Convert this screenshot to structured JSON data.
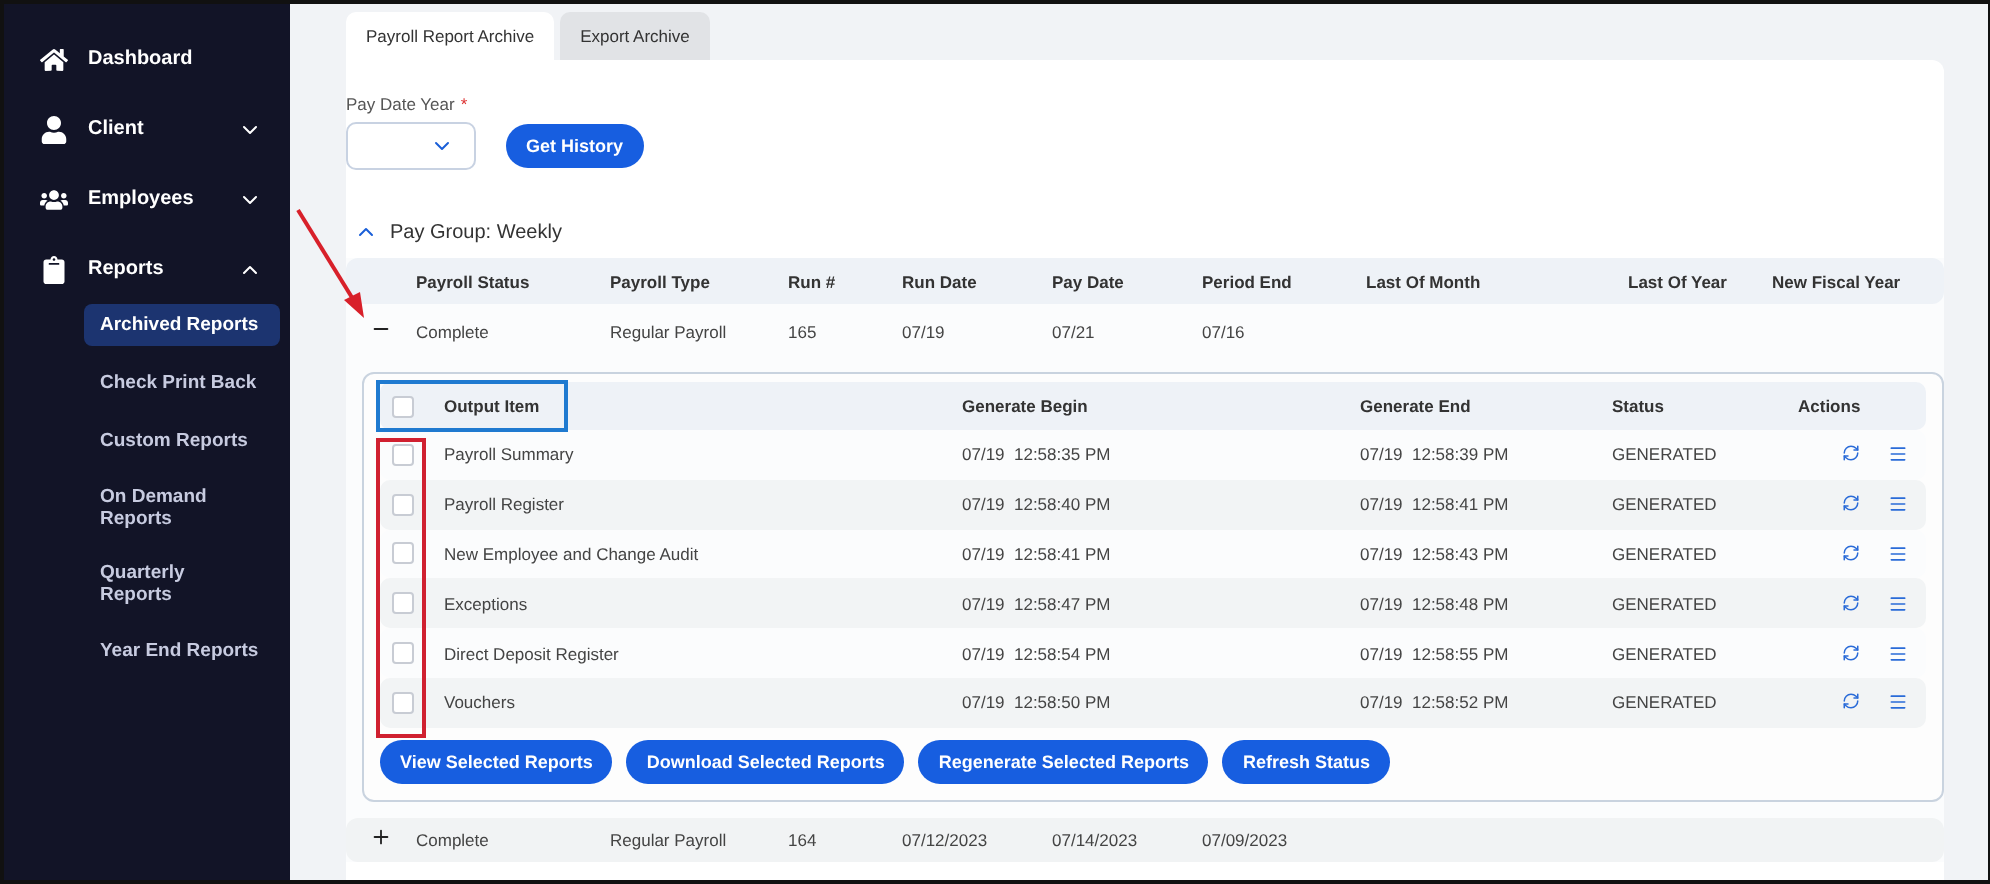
{
  "sidebar": {
    "items": [
      {
        "label": "Dashboard"
      },
      {
        "label": "Client",
        "expanded": false
      },
      {
        "label": "Employees",
        "expanded": false
      },
      {
        "label": "Reports",
        "expanded": true,
        "children": [
          {
            "label": "Archived Reports",
            "selected": true
          },
          {
            "label": "Check Print Back",
            "selected": false
          },
          {
            "label": "Custom Reports",
            "selected": false
          },
          {
            "label": "On Demand Reports",
            "selected": false
          },
          {
            "label": "Quarterly Reports",
            "selected": false
          },
          {
            "label": "Year End Reports",
            "selected": false
          }
        ]
      }
    ]
  },
  "tabs": [
    {
      "label": "Payroll Report Archive",
      "selected": true
    },
    {
      "label": "Export Archive",
      "selected": false
    }
  ],
  "filter": {
    "label": "Pay Date Year",
    "required_mark": "*",
    "button": "Get History"
  },
  "pay_group": {
    "title": "Pay Group: Weekly",
    "expanded": true,
    "columns": [
      "Payroll Status",
      "Payroll Type",
      "Run #",
      "Run Date",
      "Pay Date",
      "Period End",
      "Last Of Month",
      "Last Of Year",
      "New Fiscal Year"
    ],
    "runs": [
      {
        "expanded": true,
        "cells": [
          "Complete",
          "Regular Payroll",
          "165",
          "07/19",
          "07/21",
          "07/16"
        ]
      },
      {
        "expanded": false,
        "cells": [
          "Complete",
          "Regular Payroll",
          "164",
          "07/12/2023",
          "07/14/2023",
          "07/09/2023"
        ]
      }
    ]
  },
  "output": {
    "columns": [
      "Output Item",
      "Generate Begin",
      "Generate End",
      "Status",
      "Actions"
    ],
    "header_checked": false,
    "rows": [
      {
        "item": "Payroll Summary",
        "begin": "07/19  12:58:35 PM",
        "end": "07/19  12:58:39 PM",
        "status": "GENERATED",
        "checked": false
      },
      {
        "item": "Payroll Register",
        "begin": "07/19  12:58:40 PM",
        "end": "07/19  12:58:41 PM",
        "status": "GENERATED",
        "checked": false
      },
      {
        "item": "New Employee and Change Audit",
        "begin": "07/19  12:58:41 PM",
        "end": "07/19  12:58:43 PM",
        "status": "GENERATED",
        "checked": false
      },
      {
        "item": "Exceptions",
        "begin": "07/19  12:58:47 PM",
        "end": "07/19  12:58:48 PM",
        "status": "GENERATED",
        "checked": false
      },
      {
        "item": "Direct Deposit Register",
        "begin": "07/19  12:58:54 PM",
        "end": "07/19  12:58:55 PM",
        "status": "GENERATED",
        "checked": false
      },
      {
        "item": "Vouchers",
        "begin": "07/19  12:58:50 PM",
        "end": "07/19  12:58:52 PM",
        "status": "GENERATED",
        "checked": false
      }
    ],
    "buttons": [
      "View Selected Reports",
      "Download Selected Reports",
      "Regenerate Selected Reports",
      "Refresh Status"
    ]
  }
}
